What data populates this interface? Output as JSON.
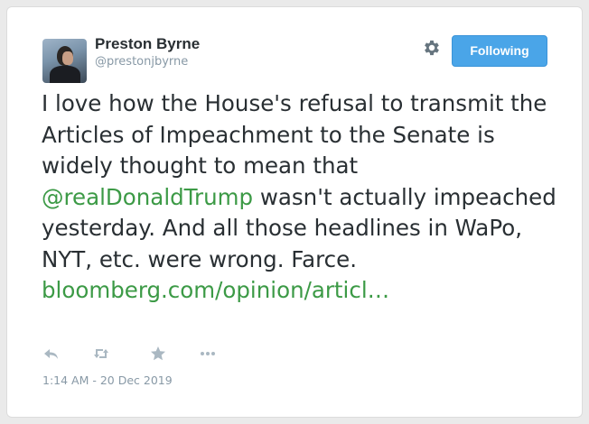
{
  "tweet": {
    "author": {
      "display_name": "Preston Byrne",
      "handle": "@prestonjbyrne",
      "avatar_icon": "profile-photo"
    },
    "follow_button": {
      "label": "Following",
      "color": "#4aa5e8"
    },
    "settings_icon": "gear-icon",
    "text_parts": {
      "before_mention": "I love how the House's refusal to transmit the Articles of Impeachment to the Senate is widely thought to mean that ",
      "mention": "@realDonaldTrump",
      "after_mention": " wasn't actually impeached yesterday. And all those headlines in WaPo, NYT, etc. were wrong. Farce. ",
      "link": "bloomberg.com/opinion/articl…"
    },
    "link_color": "#3c9a46",
    "actions": [
      {
        "name": "reply",
        "icon": "reply-icon"
      },
      {
        "name": "retweet",
        "icon": "retweet-icon"
      },
      {
        "name": "like",
        "icon": "star-icon"
      },
      {
        "name": "more",
        "icon": "more-icon"
      }
    ],
    "timestamp": "1:14 AM - 20 Dec 2019"
  }
}
